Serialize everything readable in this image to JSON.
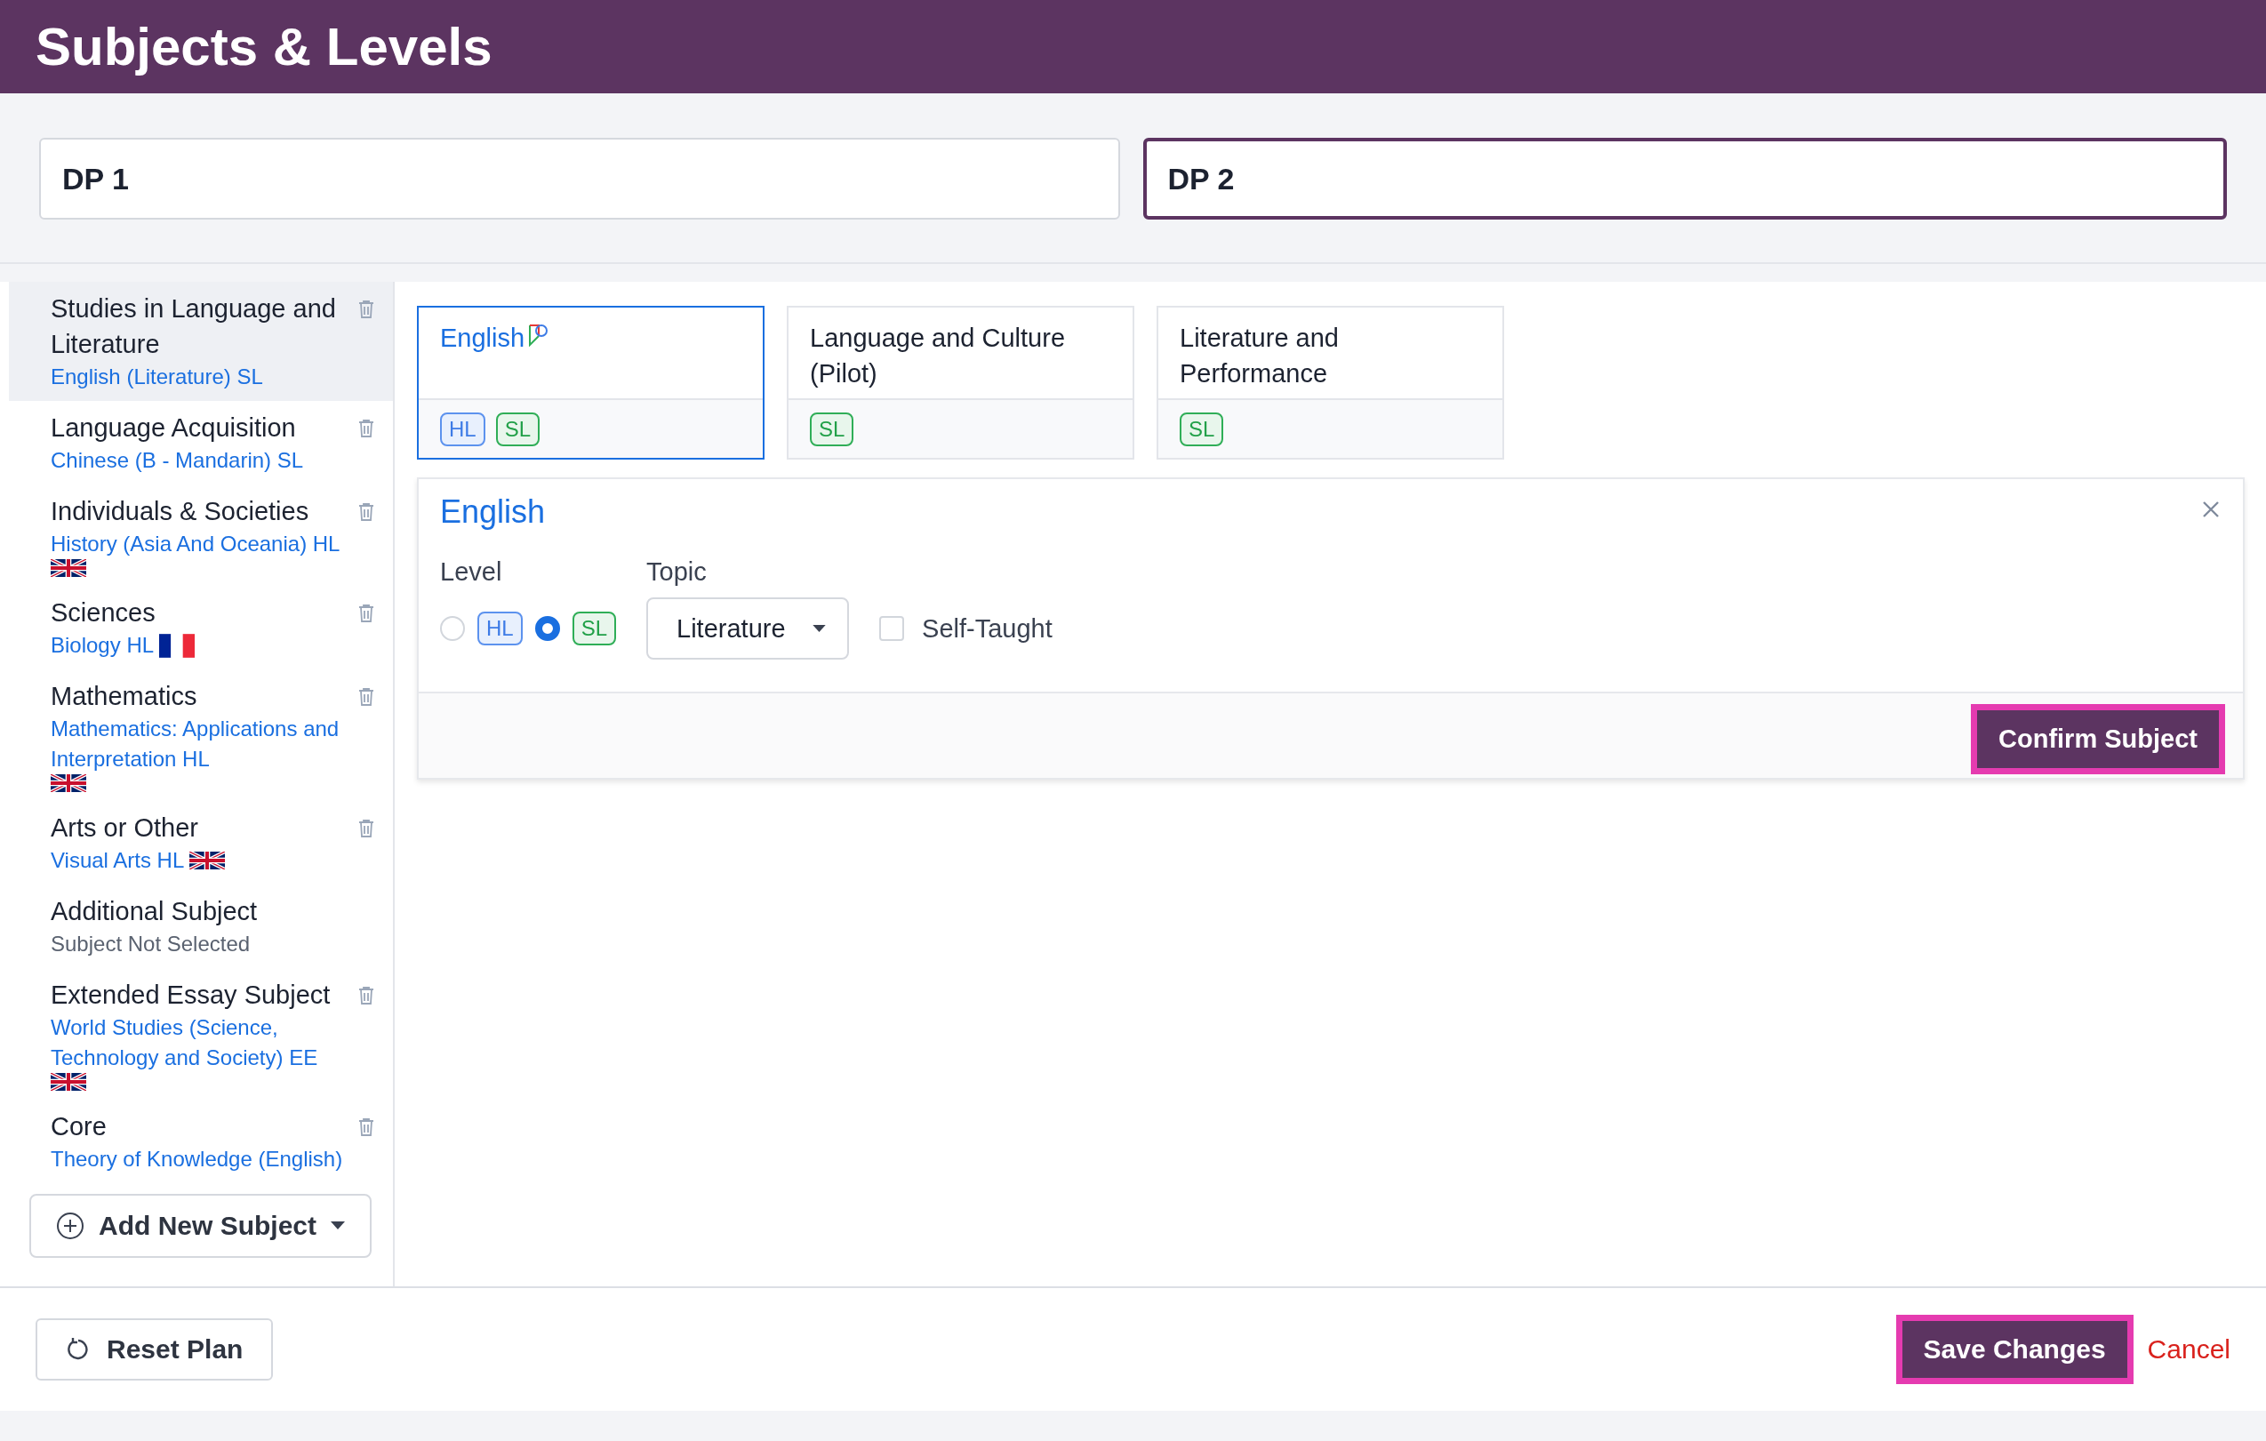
{
  "header": {
    "title": "Subjects & Levels"
  },
  "year_tabs": [
    {
      "label": "DP 1",
      "selected": false
    },
    {
      "label": "DP 2",
      "selected": true
    }
  ],
  "sidebar": {
    "items": [
      {
        "title": "Studies in Language and Literature",
        "subject": "English (Literature) SL",
        "selected": true,
        "empty": false,
        "deletable": true
      },
      {
        "title": "Language Acquisition",
        "subject": "Chinese (B - Mandarin) SL",
        "selected": false,
        "empty": false,
        "deletable": true
      },
      {
        "title": "Individuals & Societies",
        "subject": "History (Asia And Oceania) HL",
        "kind": "uk",
        "selected": false,
        "empty": false,
        "deletable": true
      },
      {
        "title": "Sciences",
        "subject": "Biology HL",
        "kind": "fr",
        "selected": false,
        "empty": false,
        "deletable": true
      },
      {
        "title": "Mathematics",
        "subject": "Mathematics: Applications and Interpretation HL",
        "kind": "uk",
        "selected": false,
        "empty": false,
        "deletable": true
      },
      {
        "title": "Arts or Other",
        "subject": "Visual Arts HL",
        "kind": "uk",
        "selected": false,
        "empty": false,
        "deletable": true
      },
      {
        "title": "Additional Subject",
        "subject": "Subject Not Selected",
        "selected": false,
        "empty": true,
        "deletable": false
      },
      {
        "title": "Extended Essay Subject",
        "subject": "World Studies (Science, Technology and Society) EE",
        "kind": "uk",
        "selected": false,
        "empty": false,
        "deletable": true
      },
      {
        "title": "Core",
        "subject": "Theory of Knowledge (English)",
        "selected": false,
        "empty": false,
        "deletable": true
      }
    ],
    "add_button": "Add New Subject"
  },
  "subject_cards": [
    {
      "name": "English",
      "selected": true,
      "marked": true,
      "levels": [
        {
          "label": "HL",
          "kind": "hl"
        },
        {
          "label": "SL",
          "kind": "sl"
        }
      ]
    },
    {
      "name": "Language and Culture (Pilot)",
      "selected": false,
      "marked": false,
      "levels": [
        {
          "label": "SL",
          "kind": "sl"
        }
      ]
    },
    {
      "name": "Literature and Performance",
      "selected": false,
      "marked": false,
      "levels": [
        {
          "label": "SL",
          "kind": "sl"
        }
      ]
    }
  ],
  "detail": {
    "title": "English",
    "level_label": "Level",
    "level_options": [
      {
        "label": "HL",
        "kind": "hl",
        "selected": false
      },
      {
        "label": "SL",
        "kind": "sl",
        "selected": true
      }
    ],
    "topic_label": "Topic",
    "topic": "Literature",
    "self_taught": {
      "label": "Self-Taught",
      "checked": false
    },
    "confirm_button": "Confirm Subject"
  },
  "footer": {
    "reset_button": "Reset Plan",
    "save_button": "Save Changes",
    "cancel_link": "Cancel"
  }
}
